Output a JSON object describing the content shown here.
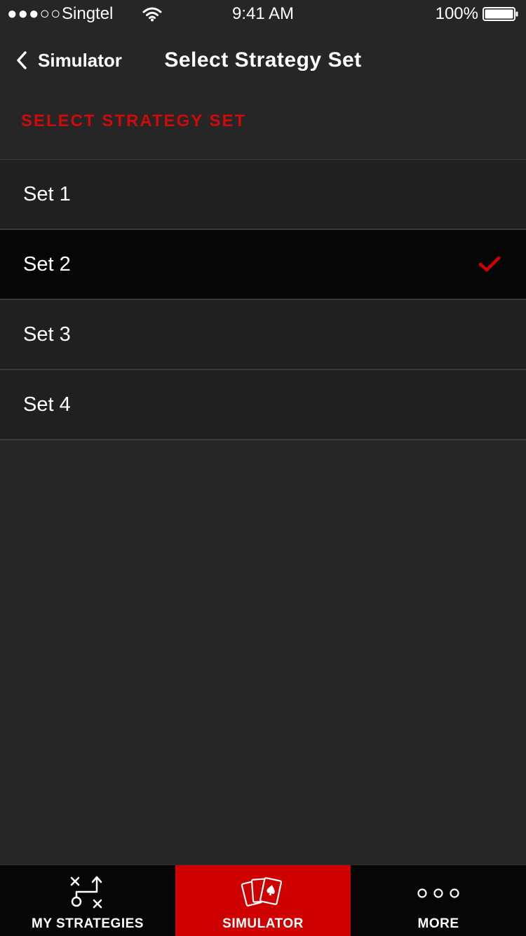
{
  "status_bar": {
    "signal": "●●●○○",
    "carrier": "Singtel",
    "time": "9:41 AM",
    "battery_percent": "100%",
    "battery_level": 1.0
  },
  "nav": {
    "back_label": "Simulator",
    "title": "Select Strategy Set"
  },
  "section": {
    "header": "SELECT STRATEGY SET"
  },
  "sets": [
    {
      "label": "Set 1",
      "selected": false
    },
    {
      "label": "Set 2",
      "selected": true
    },
    {
      "label": "Set 3",
      "selected": false
    },
    {
      "label": "Set 4",
      "selected": false
    }
  ],
  "tabs": [
    {
      "label": "MY STRATEGIES",
      "icon": "playbook-icon",
      "active": false
    },
    {
      "label": "SIMULATOR",
      "icon": "cards-icon",
      "active": true
    },
    {
      "label": "MORE",
      "icon": "more-dots-icon",
      "active": false
    }
  ],
  "colors": {
    "accent": "#cf0000",
    "background": "#262626",
    "row_background": "#202020",
    "selected_row_background": "#060606"
  }
}
